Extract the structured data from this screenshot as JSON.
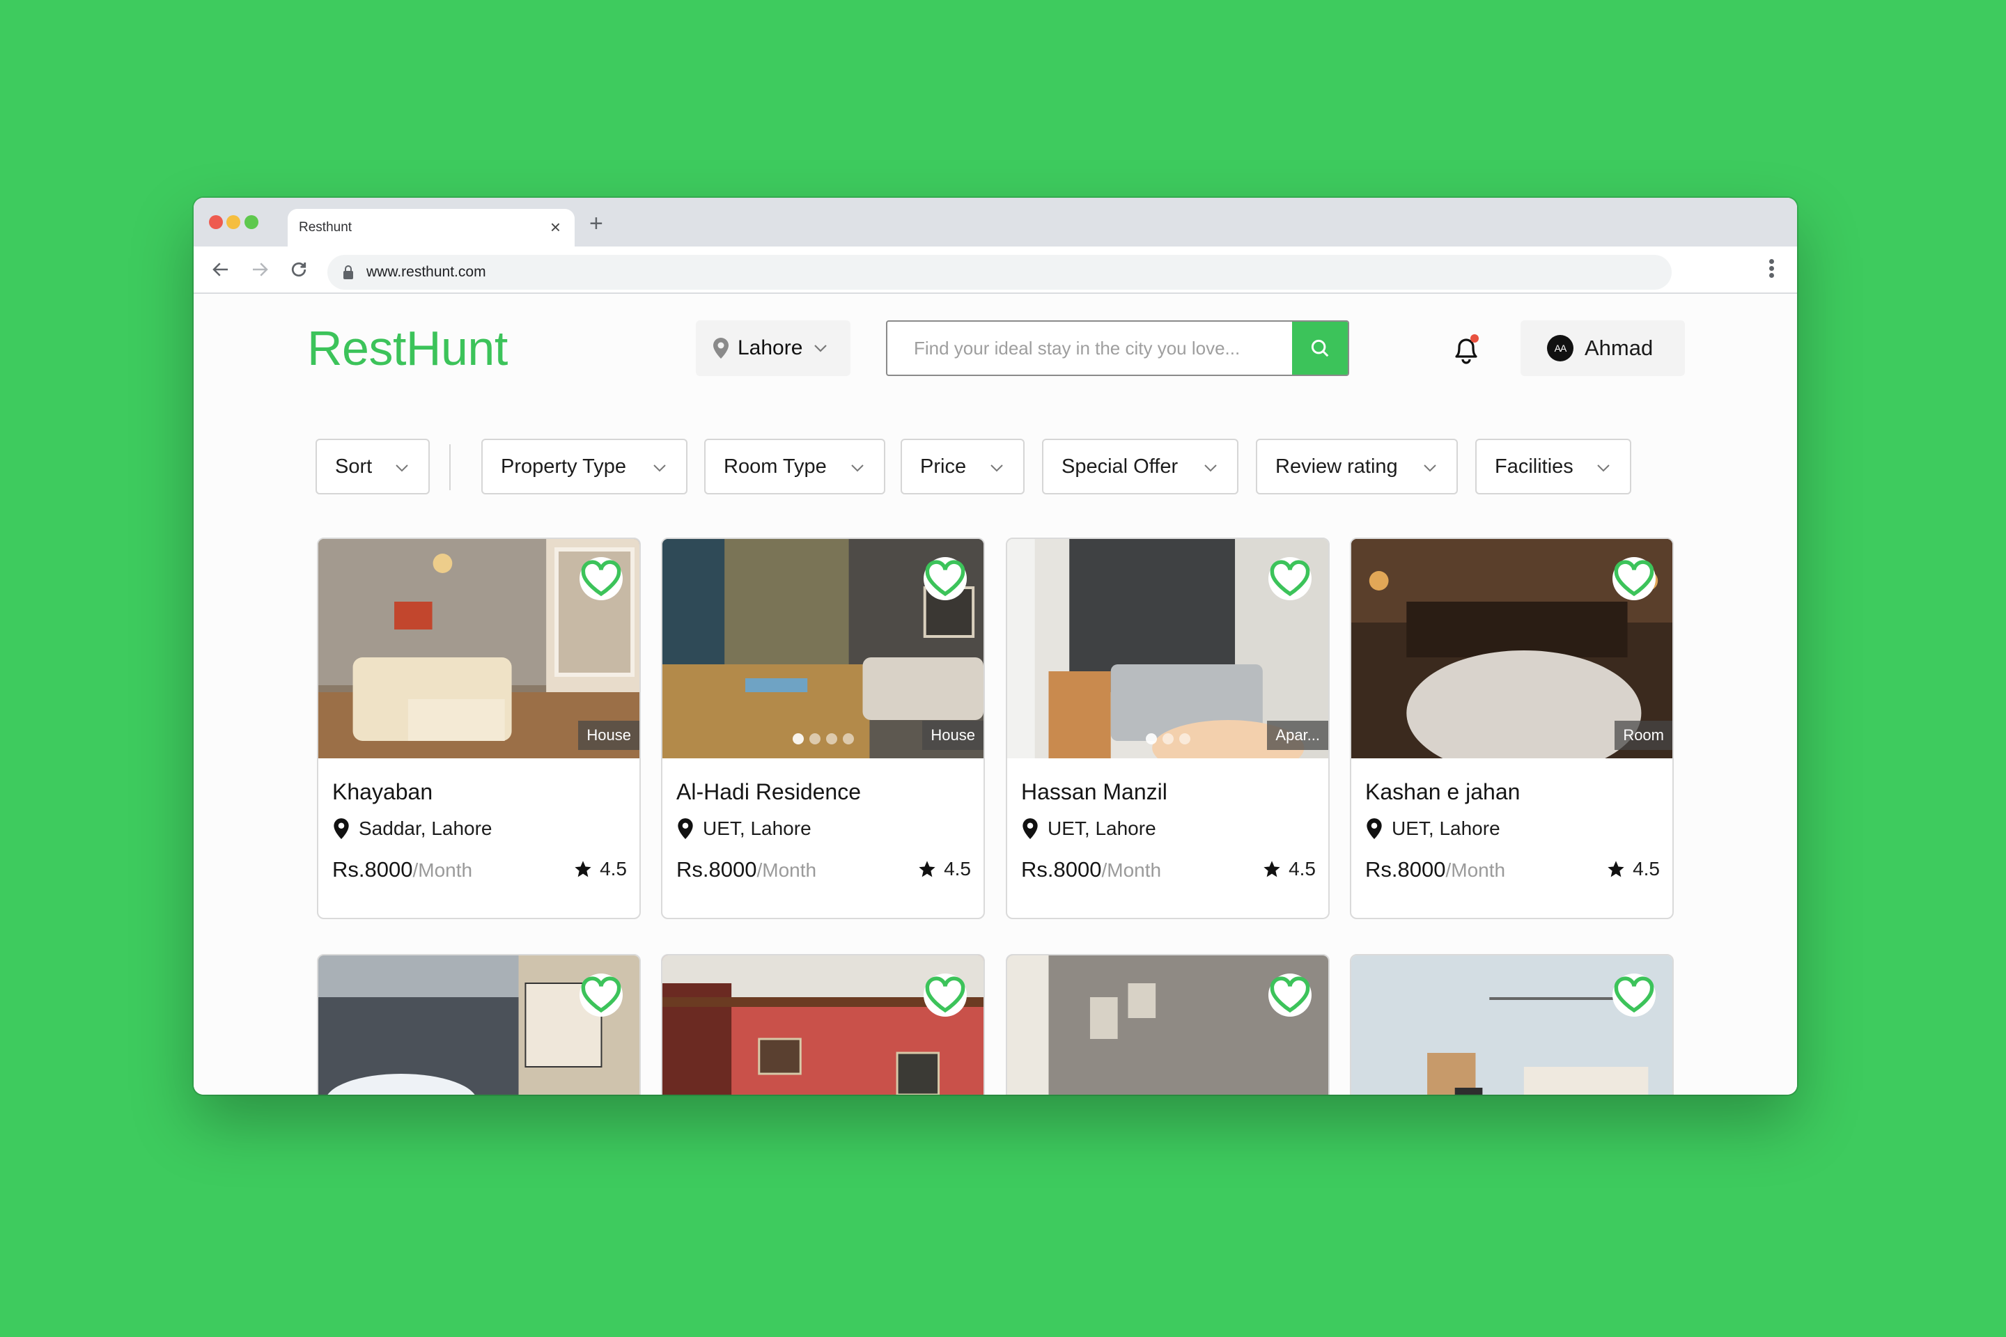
{
  "browser": {
    "tab_title": "Resthunt",
    "close_tab": "×",
    "new_tab": "+",
    "url": "www.resthunt.com"
  },
  "header": {
    "logo": "RestHunt",
    "location": "Lahore",
    "search_placeholder": "Find your ideal stay in the city you love...",
    "search_value": "",
    "notifications_unread": true,
    "user": {
      "initials": "AA",
      "name": "Ahmad"
    }
  },
  "filters": [
    {
      "label": "Sort"
    },
    {
      "label": "Property Type"
    },
    {
      "label": "Room Type"
    },
    {
      "label": "Price"
    },
    {
      "label": "Special Offer"
    },
    {
      "label": "Review rating"
    },
    {
      "label": "Facilities"
    }
  ],
  "listings": [
    {
      "name": "Khayaban",
      "location": "Saddar, Lahore",
      "price": "Rs.8000",
      "period": "/Month",
      "rating": "4.5",
      "type": "House",
      "photo_dots": 0,
      "favorited": false
    },
    {
      "name": "Al-Hadi Residence",
      "location": "UET, Lahore",
      "price": "Rs.8000",
      "period": "/Month",
      "rating": "4.5",
      "type": "House",
      "photo_dots": 4,
      "favorited": false
    },
    {
      "name": "Hassan Manzil",
      "location": "UET, Lahore",
      "price": "Rs.8000",
      "period": "/Month",
      "rating": "4.5",
      "type": "Apar...",
      "photo_dots": 3,
      "favorited": false
    },
    {
      "name": "Kashan e jahan",
      "location": "UET, Lahore",
      "price": "Rs.8000",
      "period": "/Month",
      "rating": "4.5",
      "type": "Room",
      "photo_dots": 0,
      "favorited": false
    },
    {
      "name": "",
      "location": "",
      "price": "",
      "period": "",
      "rating": "",
      "type": "",
      "photo_dots": 0,
      "favorited": false
    },
    {
      "name": "",
      "location": "",
      "price": "",
      "period": "",
      "rating": "",
      "type": "",
      "photo_dots": 0,
      "favorited": false
    },
    {
      "name": "",
      "location": "",
      "price": "",
      "period": "",
      "rating": "",
      "type": "",
      "photo_dots": 0,
      "favorited": false
    },
    {
      "name": "",
      "location": "",
      "price": "",
      "period": "",
      "rating": "",
      "type": "",
      "photo_dots": 0,
      "favorited": false
    }
  ],
  "colors": {
    "background": "#3ecb5e",
    "brand": "#3cc35a",
    "notification_dot": "#e8513f"
  }
}
